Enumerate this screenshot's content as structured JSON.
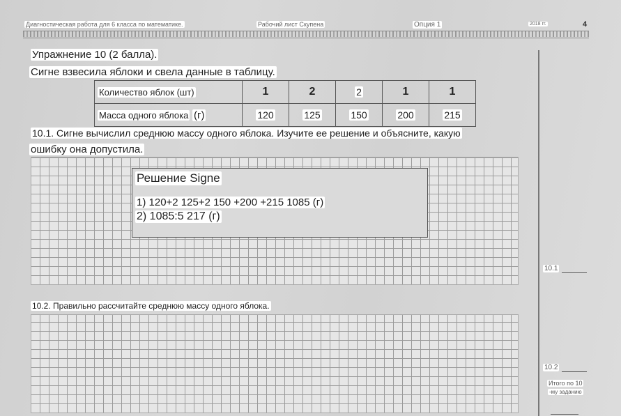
{
  "header": {
    "left": "Диагностическая работа для 6 класса по математике.",
    "center": "Рабочий лист Скупена",
    "option": "Опция 1",
    "year": "2018 гг.",
    "page_number": "4"
  },
  "exercise": {
    "title": "Упражнение 10 (2 балла).",
    "intro": "Сигне взвесила яблоки и свела данные в таблицу.",
    "table": {
      "row1_header": "Количество яблок (шт)",
      "row1_values": [
        "1",
        "2",
        "2",
        "1",
        "1"
      ],
      "row2_header_text": "Масса одного яблока",
      "row2_header_unit": "(г)",
      "row2_values": [
        "120",
        "125",
        "150",
        "200",
        "215"
      ]
    },
    "q1_line1": "10.1. Сигне вычислил среднюю массу одного яблока. Изучите ее решение и объясните, какую",
    "q1_line2": "ошибку она допустила.",
    "solution": {
      "title": "Решение Signe",
      "line1": "1) 120+2 125+2 150 +200 +215 1085 (г)",
      "line2": "2) 1085:5 217 (г)"
    },
    "q2": "10.2. Правильно рассчитайте среднюю массу одного яблока."
  },
  "scores": {
    "s1": "10.1",
    "s2": "10.2",
    "total_line1": "Итого по 10",
    "total_line2": "-му заданию"
  }
}
